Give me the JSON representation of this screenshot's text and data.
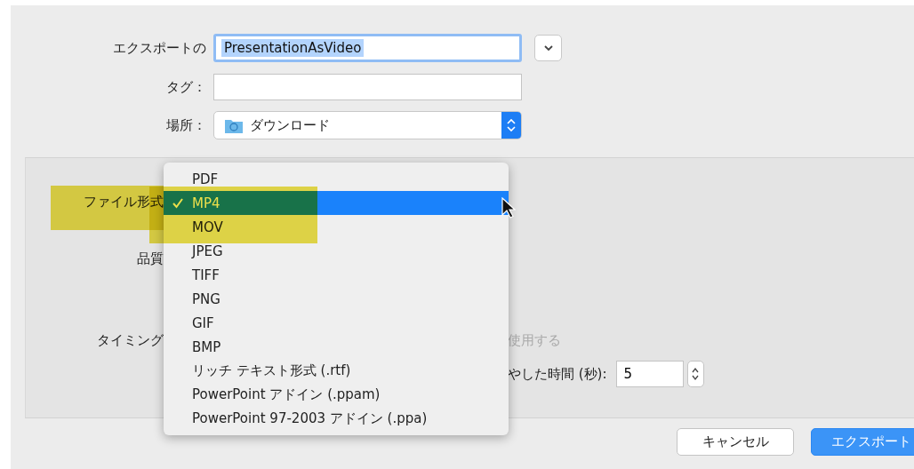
{
  "form": {
    "name_label": "エクスポートの",
    "name_value": "PresentationAsVideo",
    "tags_label": "タグ：",
    "location_label": "場所：",
    "location_value": "ダウンロード"
  },
  "options": {
    "format_label": "ファイル形式",
    "format_highlighted": true,
    "quality_label": "品質",
    "timing_label": "タイミング",
    "use_label": "使用する",
    "duration_label": "やした時間 (秒):",
    "duration_value": "5"
  },
  "format_menu": [
    {
      "label": "PDF",
      "selected": false,
      "highlighted": false
    },
    {
      "label": "MP4",
      "selected": true,
      "highlighted": true
    },
    {
      "label": "MOV",
      "selected": false,
      "highlighted": true
    },
    {
      "label": "JPEG",
      "selected": false,
      "highlighted": false
    },
    {
      "label": "TIFF",
      "selected": false,
      "highlighted": false
    },
    {
      "label": "PNG",
      "selected": false,
      "highlighted": false
    },
    {
      "label": "GIF",
      "selected": false,
      "highlighted": false
    },
    {
      "label": "BMP",
      "selected": false,
      "highlighted": false
    },
    {
      "label": "リッチ テキスト形式 (.rtf)",
      "selected": false,
      "highlighted": false
    },
    {
      "label": "PowerPoint アドイン (.ppam)",
      "selected": false,
      "highlighted": false
    },
    {
      "label": "PowerPoint 97-2003 アドイン (.ppa)",
      "selected": false,
      "highlighted": false
    }
  ],
  "buttons": {
    "cancel": "キャンセル",
    "export": "エクスポート"
  }
}
